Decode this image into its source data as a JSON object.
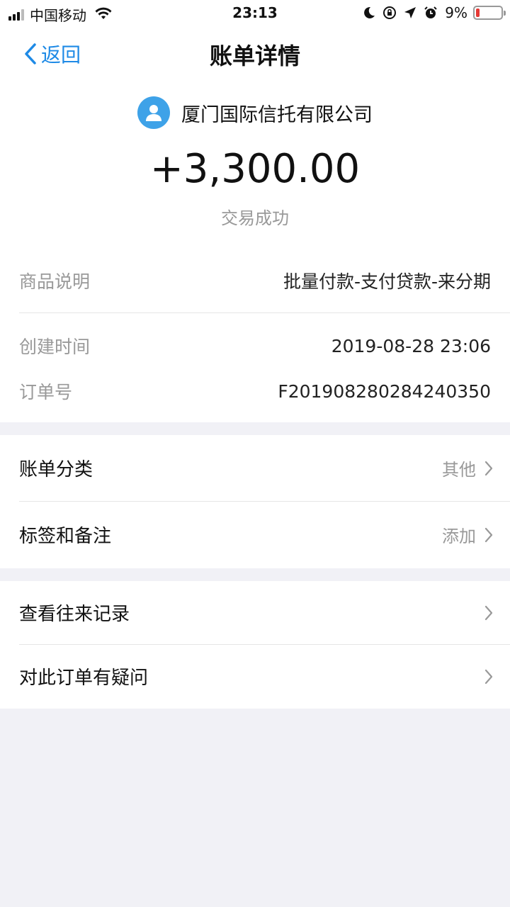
{
  "status_bar": {
    "carrier": "中国移动",
    "time": "23:13",
    "battery_percent": "9%",
    "battery_level": 0.09,
    "icons": [
      "signal-icon",
      "wifi-icon",
      "moon-icon",
      "rotation-lock-icon",
      "location-icon",
      "alarm-icon",
      "battery-icon"
    ]
  },
  "nav": {
    "back_label": "返回",
    "title": "账单详情"
  },
  "summary": {
    "payee": "厦门国际信托有限公司",
    "amount": "+3,300.00",
    "status": "交易成功"
  },
  "details": {
    "product_label": "商品说明",
    "product_value": "批量付款-支付贷款-来分期",
    "created_label": "创建时间",
    "created_value": "2019-08-28 23:06",
    "order_label": "订单号",
    "order_value": "F201908280284240350"
  },
  "settings": {
    "category_label": "账单分类",
    "category_value": "其他",
    "tags_label": "标签和备注",
    "tags_value": "添加"
  },
  "actions": {
    "history_label": "查看往来记录",
    "question_label": "对此订单有疑问"
  },
  "colors": {
    "accent": "#1e8ae6",
    "avatar": "#3ea2e8",
    "background": "#f1f1f6",
    "muted": "#999999"
  }
}
